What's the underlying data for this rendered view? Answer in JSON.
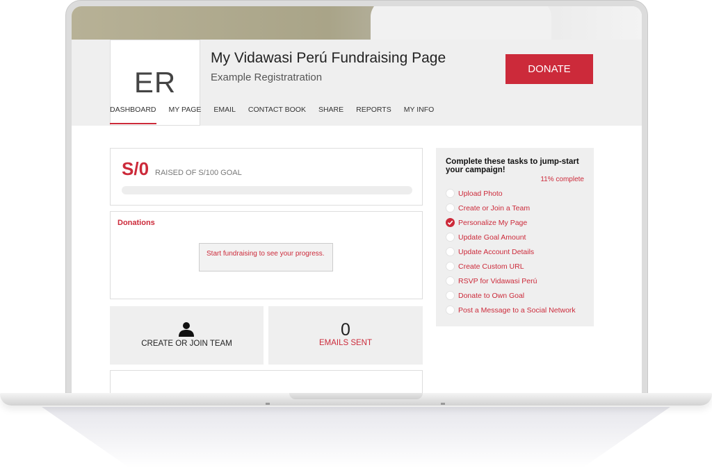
{
  "header": {
    "avatar_initials": "ER",
    "title": "My Vidawasi Perú Fundraising Page",
    "subtitle": "Example Registratration",
    "donate_label": "DONATE"
  },
  "nav": {
    "items": [
      {
        "label": "DASHBOARD",
        "active": true
      },
      {
        "label": "MY PAGE",
        "active": false
      },
      {
        "label": "EMAIL",
        "active": false
      },
      {
        "label": "CONTACT BOOK",
        "active": false
      },
      {
        "label": "SHARE",
        "active": false
      },
      {
        "label": "REPORTS",
        "active": false
      },
      {
        "label": "MY INFO",
        "active": false
      }
    ]
  },
  "fundraising": {
    "raised": "S/0",
    "raised_label": "RAISED OF S/100 GOAL",
    "progress_fraction": 0
  },
  "donations": {
    "title": "Donations",
    "empty_message": "Start fundraising to see your progress."
  },
  "tiles": {
    "team_label": "CREATE OR JOIN TEAM",
    "emails_count": "0",
    "emails_label": "EMAILS SENT"
  },
  "tasks": {
    "heading": "Complete these tasks to jump-start your campaign!",
    "progress": "11% complete",
    "items": [
      {
        "label": "Upload Photo",
        "done": false
      },
      {
        "label": "Create or Join a Team",
        "done": false
      },
      {
        "label": "Personalize My Page",
        "done": true
      },
      {
        "label": "Update Goal Amount",
        "done": false
      },
      {
        "label": "Update Account Details",
        "done": false
      },
      {
        "label": "Create Custom URL",
        "done": false
      },
      {
        "label": "RSVP for Vidawasi Perú",
        "done": false
      },
      {
        "label": "Donate to Own Goal",
        "done": false
      },
      {
        "label": "Post a Message to a Social Network",
        "done": false
      }
    ]
  },
  "colors": {
    "accent": "#cc2a3a",
    "panel": "#efefef"
  },
  "icons": {
    "team": "person-icon",
    "task_done": "checkmark-icon"
  }
}
